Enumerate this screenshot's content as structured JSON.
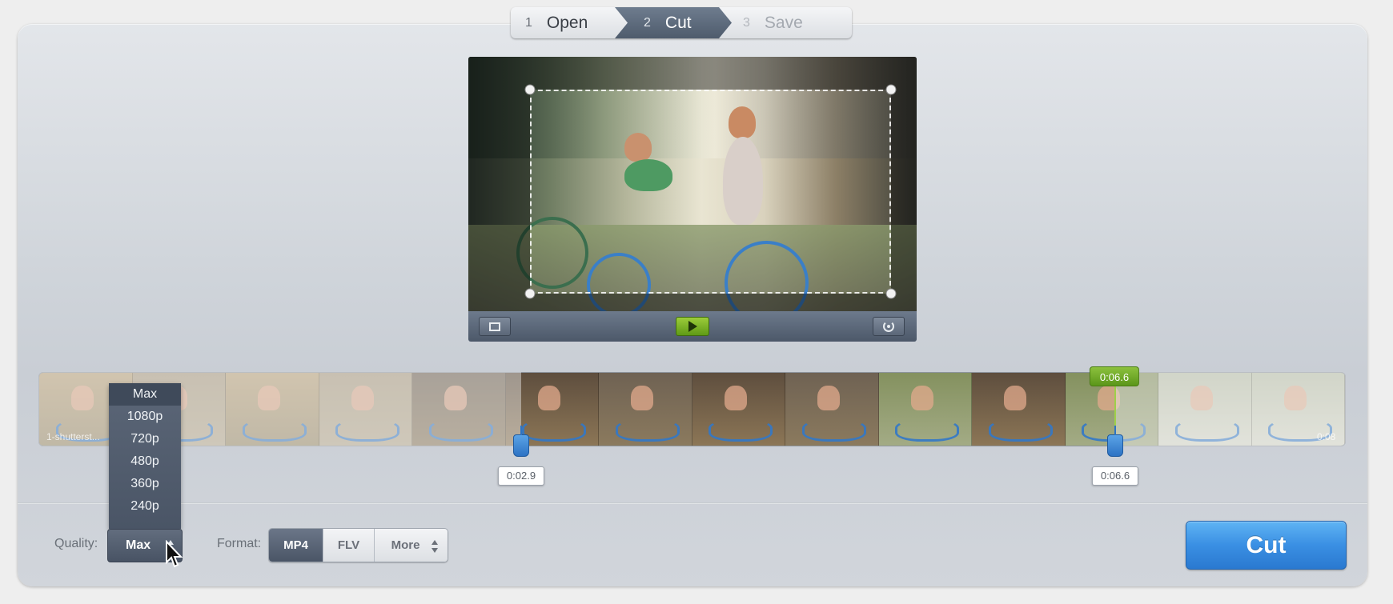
{
  "steps": [
    {
      "num": "1",
      "label": "Open"
    },
    {
      "num": "2",
      "label": "Cut"
    },
    {
      "num": "3",
      "label": "Save"
    }
  ],
  "timeline": {
    "start_label": "0:02.9",
    "end_label": "0:06.6",
    "playhead_label": "0:06.6",
    "file_name_overlay": "1-shutterst...",
    "duration_overlay": "0:08"
  },
  "quality": {
    "label": "Quality:",
    "selected": "Max",
    "options": [
      "Max",
      "1080p",
      "720p",
      "480p",
      "360p",
      "240p"
    ]
  },
  "format": {
    "label": "Format:",
    "options": [
      "MP4",
      "FLV",
      "More"
    ],
    "selected": "MP4"
  },
  "cut_button": "Cut",
  "icons": {
    "crop": "crop-icon",
    "play": "play-icon",
    "reset": "reset-icon",
    "updown": "updown-arrows-icon"
  },
  "colors": {
    "accent_blue": "#3a8fe3",
    "play_green": "#6fae22",
    "toolbar_slate": "#5b6778"
  }
}
